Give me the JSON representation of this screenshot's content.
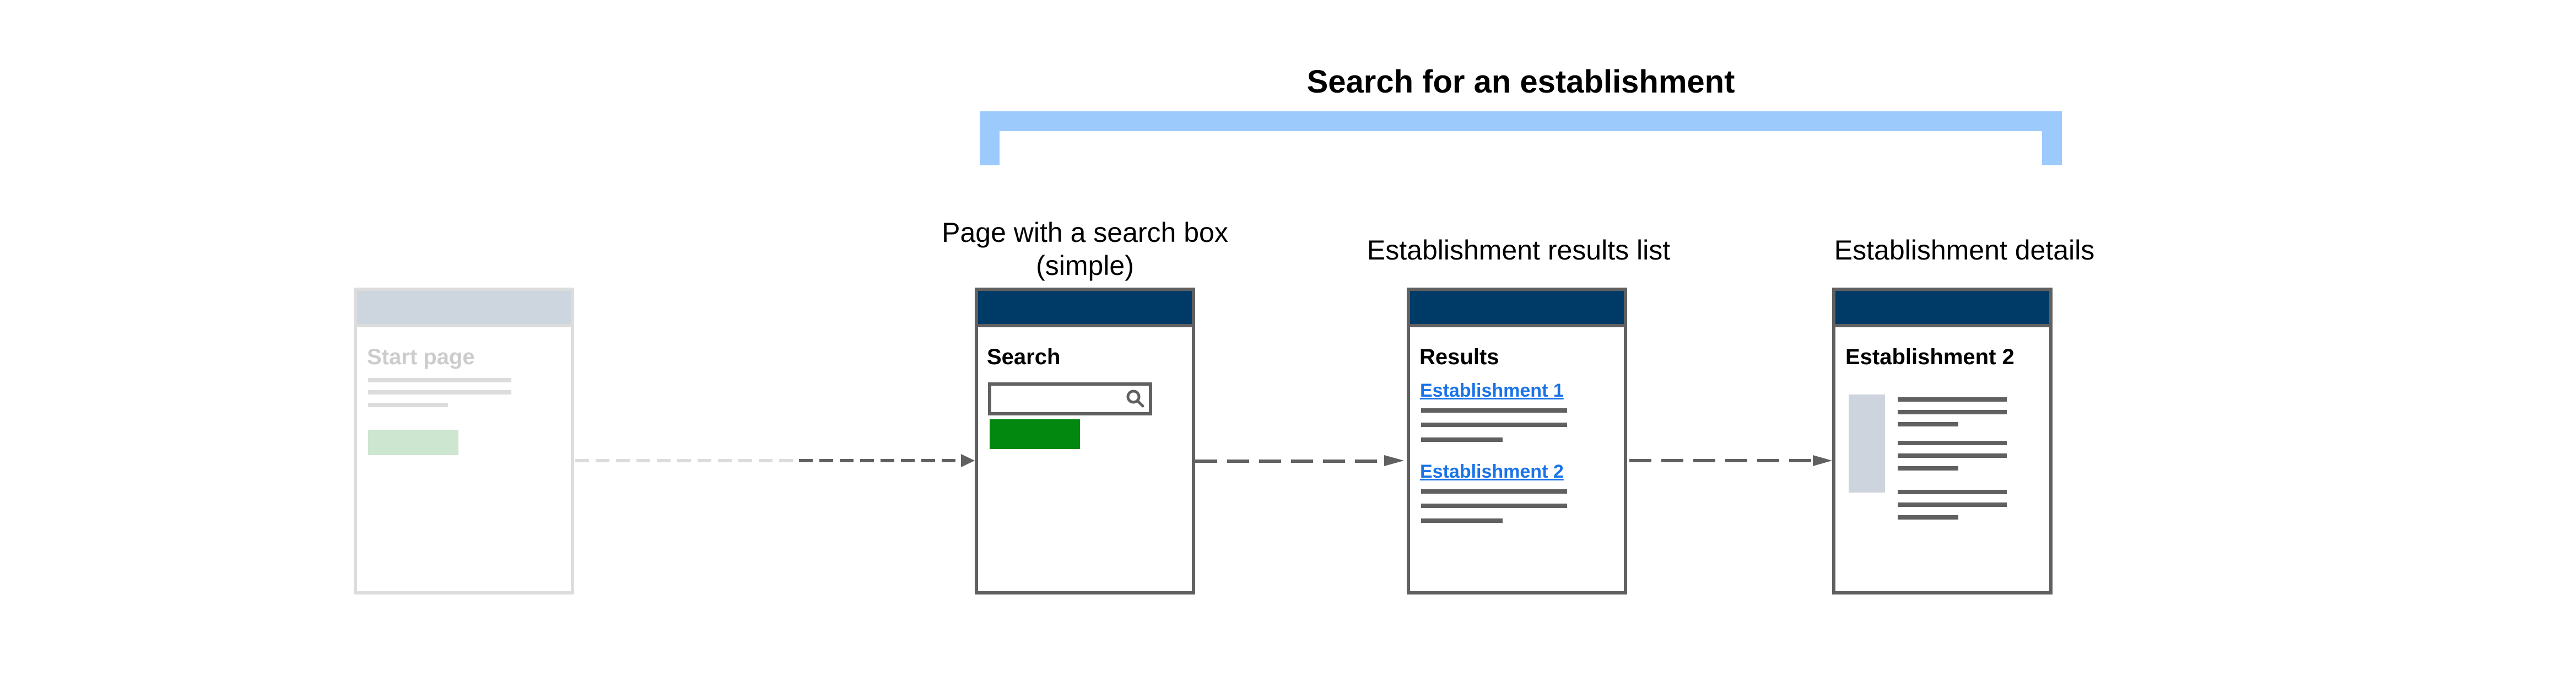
{
  "group": {
    "title": "Search for an establishment",
    "bracket_color": "#9dcafc"
  },
  "steps": [
    {
      "label": "",
      "page_title": "Start page",
      "state": "faded",
      "has_button": true
    },
    {
      "label_line1": "Page with a search box",
      "label_line2": "(simple)",
      "page_title": "Search",
      "search_input": {
        "value": "",
        "placeholder": ""
      },
      "search_icon": "magnifier-icon",
      "has_button": true
    },
    {
      "label": "Establishment results list",
      "page_title": "Results",
      "results": [
        {
          "link": "Establishment 1"
        },
        {
          "link": "Establishment 2"
        }
      ]
    },
    {
      "label": "Establishment details",
      "page_title": "Establishment 2",
      "image_placeholder": true
    }
  ],
  "colors": {
    "header": "#003a66",
    "frame_border": "#606060",
    "link": "#1a73e8",
    "button": "#03880f",
    "faded_border": "#dcdcdc",
    "faded_header": "#cdd6df",
    "faded_button": "#cde6cf",
    "connector": "#606060"
  },
  "connectors": [
    {
      "from": "Start page",
      "to": "Page with a search box",
      "style": "dashed-arrow"
    },
    {
      "from": "Page with a search box",
      "to": "Establishment results list",
      "style": "dashed-arrow"
    },
    {
      "from": "Establishment results list",
      "to": "Establishment details",
      "style": "dashed-arrow"
    }
  ]
}
